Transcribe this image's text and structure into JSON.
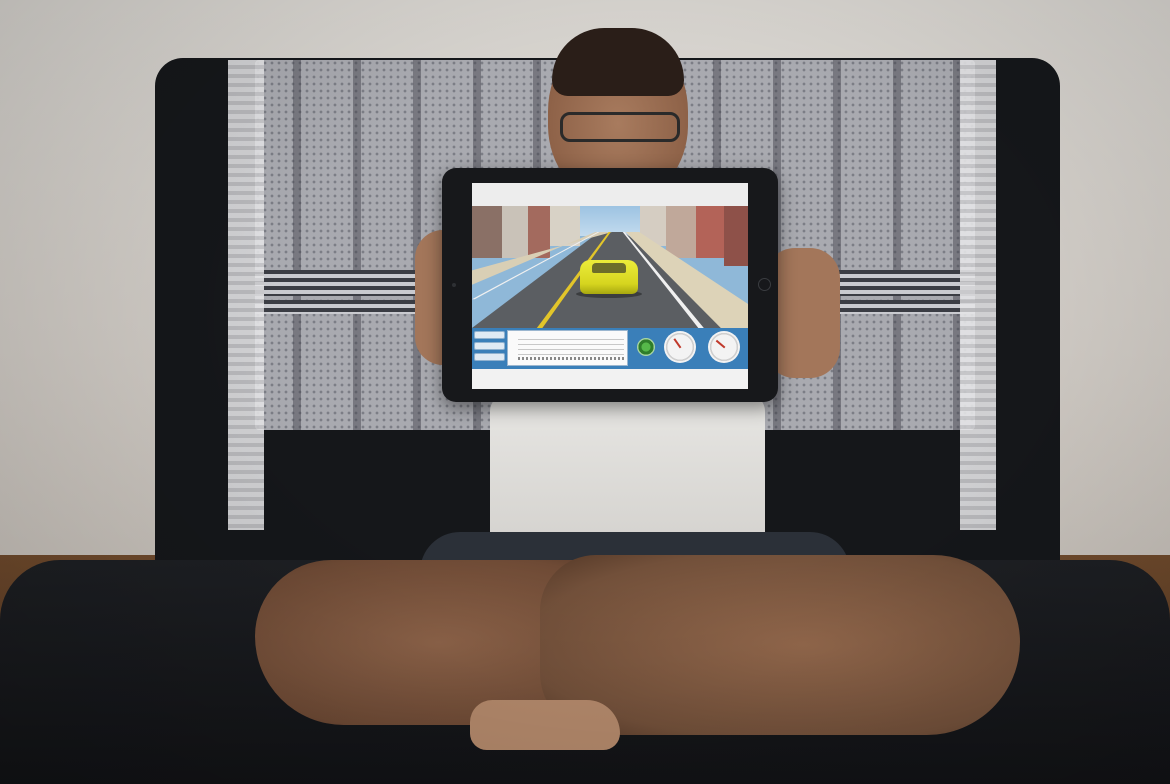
{
  "photo": {
    "subject": "person-holding-tablet",
    "colors": {
      "futon": "#15171a",
      "blanket": "#a9aab0",
      "wall": "#d7d4cf",
      "floor": "#5a3a25",
      "tablet_frame": "#17181b",
      "dashboard": "#3a7fb9",
      "car": "#e2e22a"
    }
  },
  "tablet_app": {
    "viewport": {
      "scene": "city-street-driving",
      "vehicle_color": "#e2e22a"
    },
    "dashboard": {
      "buttons": [
        "",
        "",
        ""
      ],
      "telemetry_panel": "graph",
      "gauges": [
        "status-light",
        "speedometer",
        "tachometer"
      ]
    }
  }
}
